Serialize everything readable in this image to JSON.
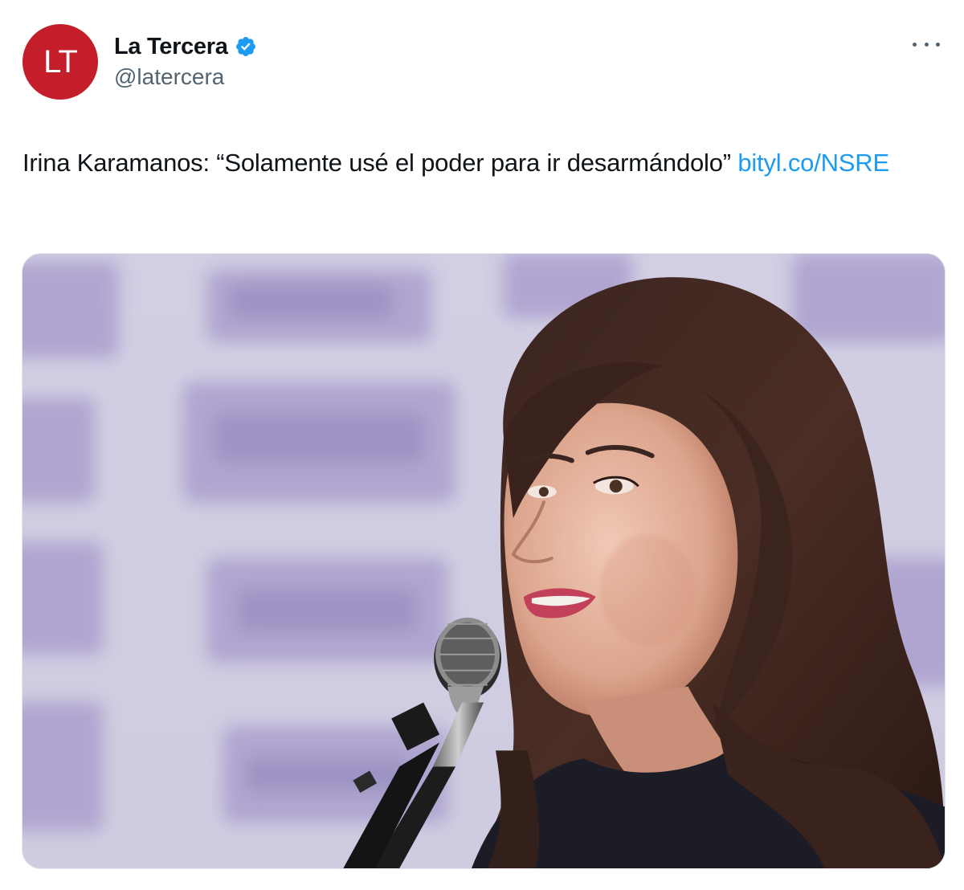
{
  "author": {
    "avatar_initials": "LT",
    "avatar_color": "#c41e2b",
    "display_name": "La Tercera",
    "handle": "@latercera",
    "verified": true,
    "verified_color": "#1d9bf0"
  },
  "tweet": {
    "text": "Irina Karamanos: “Solamente usé el poder para ir desarmándolo” ",
    "link_text": "bityl.co/​NSRE",
    "link_color": "#1d9bf0"
  },
  "media": {
    "alt": "photo",
    "icon": "photo"
  },
  "menu": {
    "icon": "more-options-icon"
  }
}
